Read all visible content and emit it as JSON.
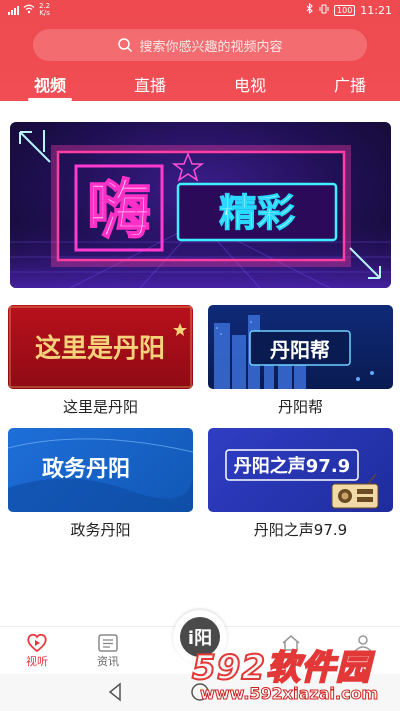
{
  "status": {
    "net_speed_top": "2.2",
    "net_speed_unit": "K/s",
    "battery": "100",
    "time": "11:21"
  },
  "search": {
    "placeholder": "搜索你感兴趣的视频内容"
  },
  "tabs": [
    {
      "label": "视频",
      "active": true
    },
    {
      "label": "直播",
      "active": false
    },
    {
      "label": "电视",
      "active": false
    },
    {
      "label": "广播",
      "active": false
    }
  ],
  "banner": {
    "text_big": "嗨",
    "text_small": "精彩"
  },
  "cards": [
    {
      "label": "这里是丹阳",
      "thumb_text": "这里是丹阳"
    },
    {
      "label": "丹阳帮",
      "thumb_text": "丹阳帮"
    },
    {
      "label": "政务丹阳",
      "thumb_text": "政务丹阳"
    },
    {
      "label": "丹阳之声97.9",
      "thumb_text": "丹阳之声97.9"
    }
  ],
  "bottom_nav": [
    {
      "label": "视听",
      "icon": "play-heart-icon",
      "active": true
    },
    {
      "label": "资讯",
      "icon": "news-icon",
      "active": false
    },
    {
      "label": "",
      "icon": "home-icon",
      "active": false
    },
    {
      "label": "",
      "icon": "user-icon",
      "active": false
    }
  ],
  "center_button": {
    "text": "i阳",
    "icon": "app-logo-icon"
  },
  "watermark": {
    "big": "592软件园",
    "small": "www.592xiazai.com"
  },
  "colors": {
    "brand_red": "#f04e54",
    "active_red": "#e8383e"
  }
}
